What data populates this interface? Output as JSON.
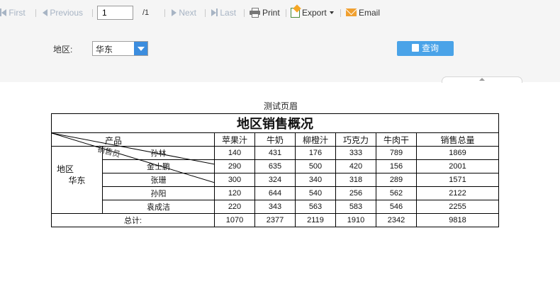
{
  "toolbar": {
    "first": "First",
    "previous": "Previous",
    "page_value": "1",
    "page_total": "/1",
    "next": "Next",
    "last": "Last",
    "print": "Print",
    "export": "Export",
    "email": "Email"
  },
  "filter": {
    "label": "地区:",
    "region_value": "华东",
    "query_button": "查询"
  },
  "report": {
    "page_header": "测试页眉",
    "title": "地区销售概况",
    "corner_product": "产品",
    "corner_salesperson": "销售员",
    "corner_region": "地区",
    "columns": [
      "苹果汁",
      "牛奶",
      "柳橙汁",
      "巧克力",
      "牛肉干",
      "销售总量"
    ],
    "region": "华东",
    "rows": [
      {
        "name": "孙林",
        "values": [
          "140",
          "431",
          "176",
          "333",
          "789",
          "1869"
        ]
      },
      {
        "name": "金士鹏",
        "values": [
          "290",
          "635",
          "500",
          "420",
          "156",
          "2001"
        ]
      },
      {
        "name": "张珊",
        "values": [
          "300",
          "324",
          "340",
          "318",
          "289",
          "1571"
        ]
      },
      {
        "name": "孙阳",
        "values": [
          "120",
          "644",
          "540",
          "256",
          "562",
          "2122"
        ]
      },
      {
        "name": "袁成洁",
        "values": [
          "220",
          "343",
          "563",
          "583",
          "546",
          "2255"
        ]
      }
    ],
    "total_label": "总计:",
    "totals": [
      "1070",
      "2377",
      "2119",
      "1910",
      "2342",
      "9818"
    ]
  }
}
